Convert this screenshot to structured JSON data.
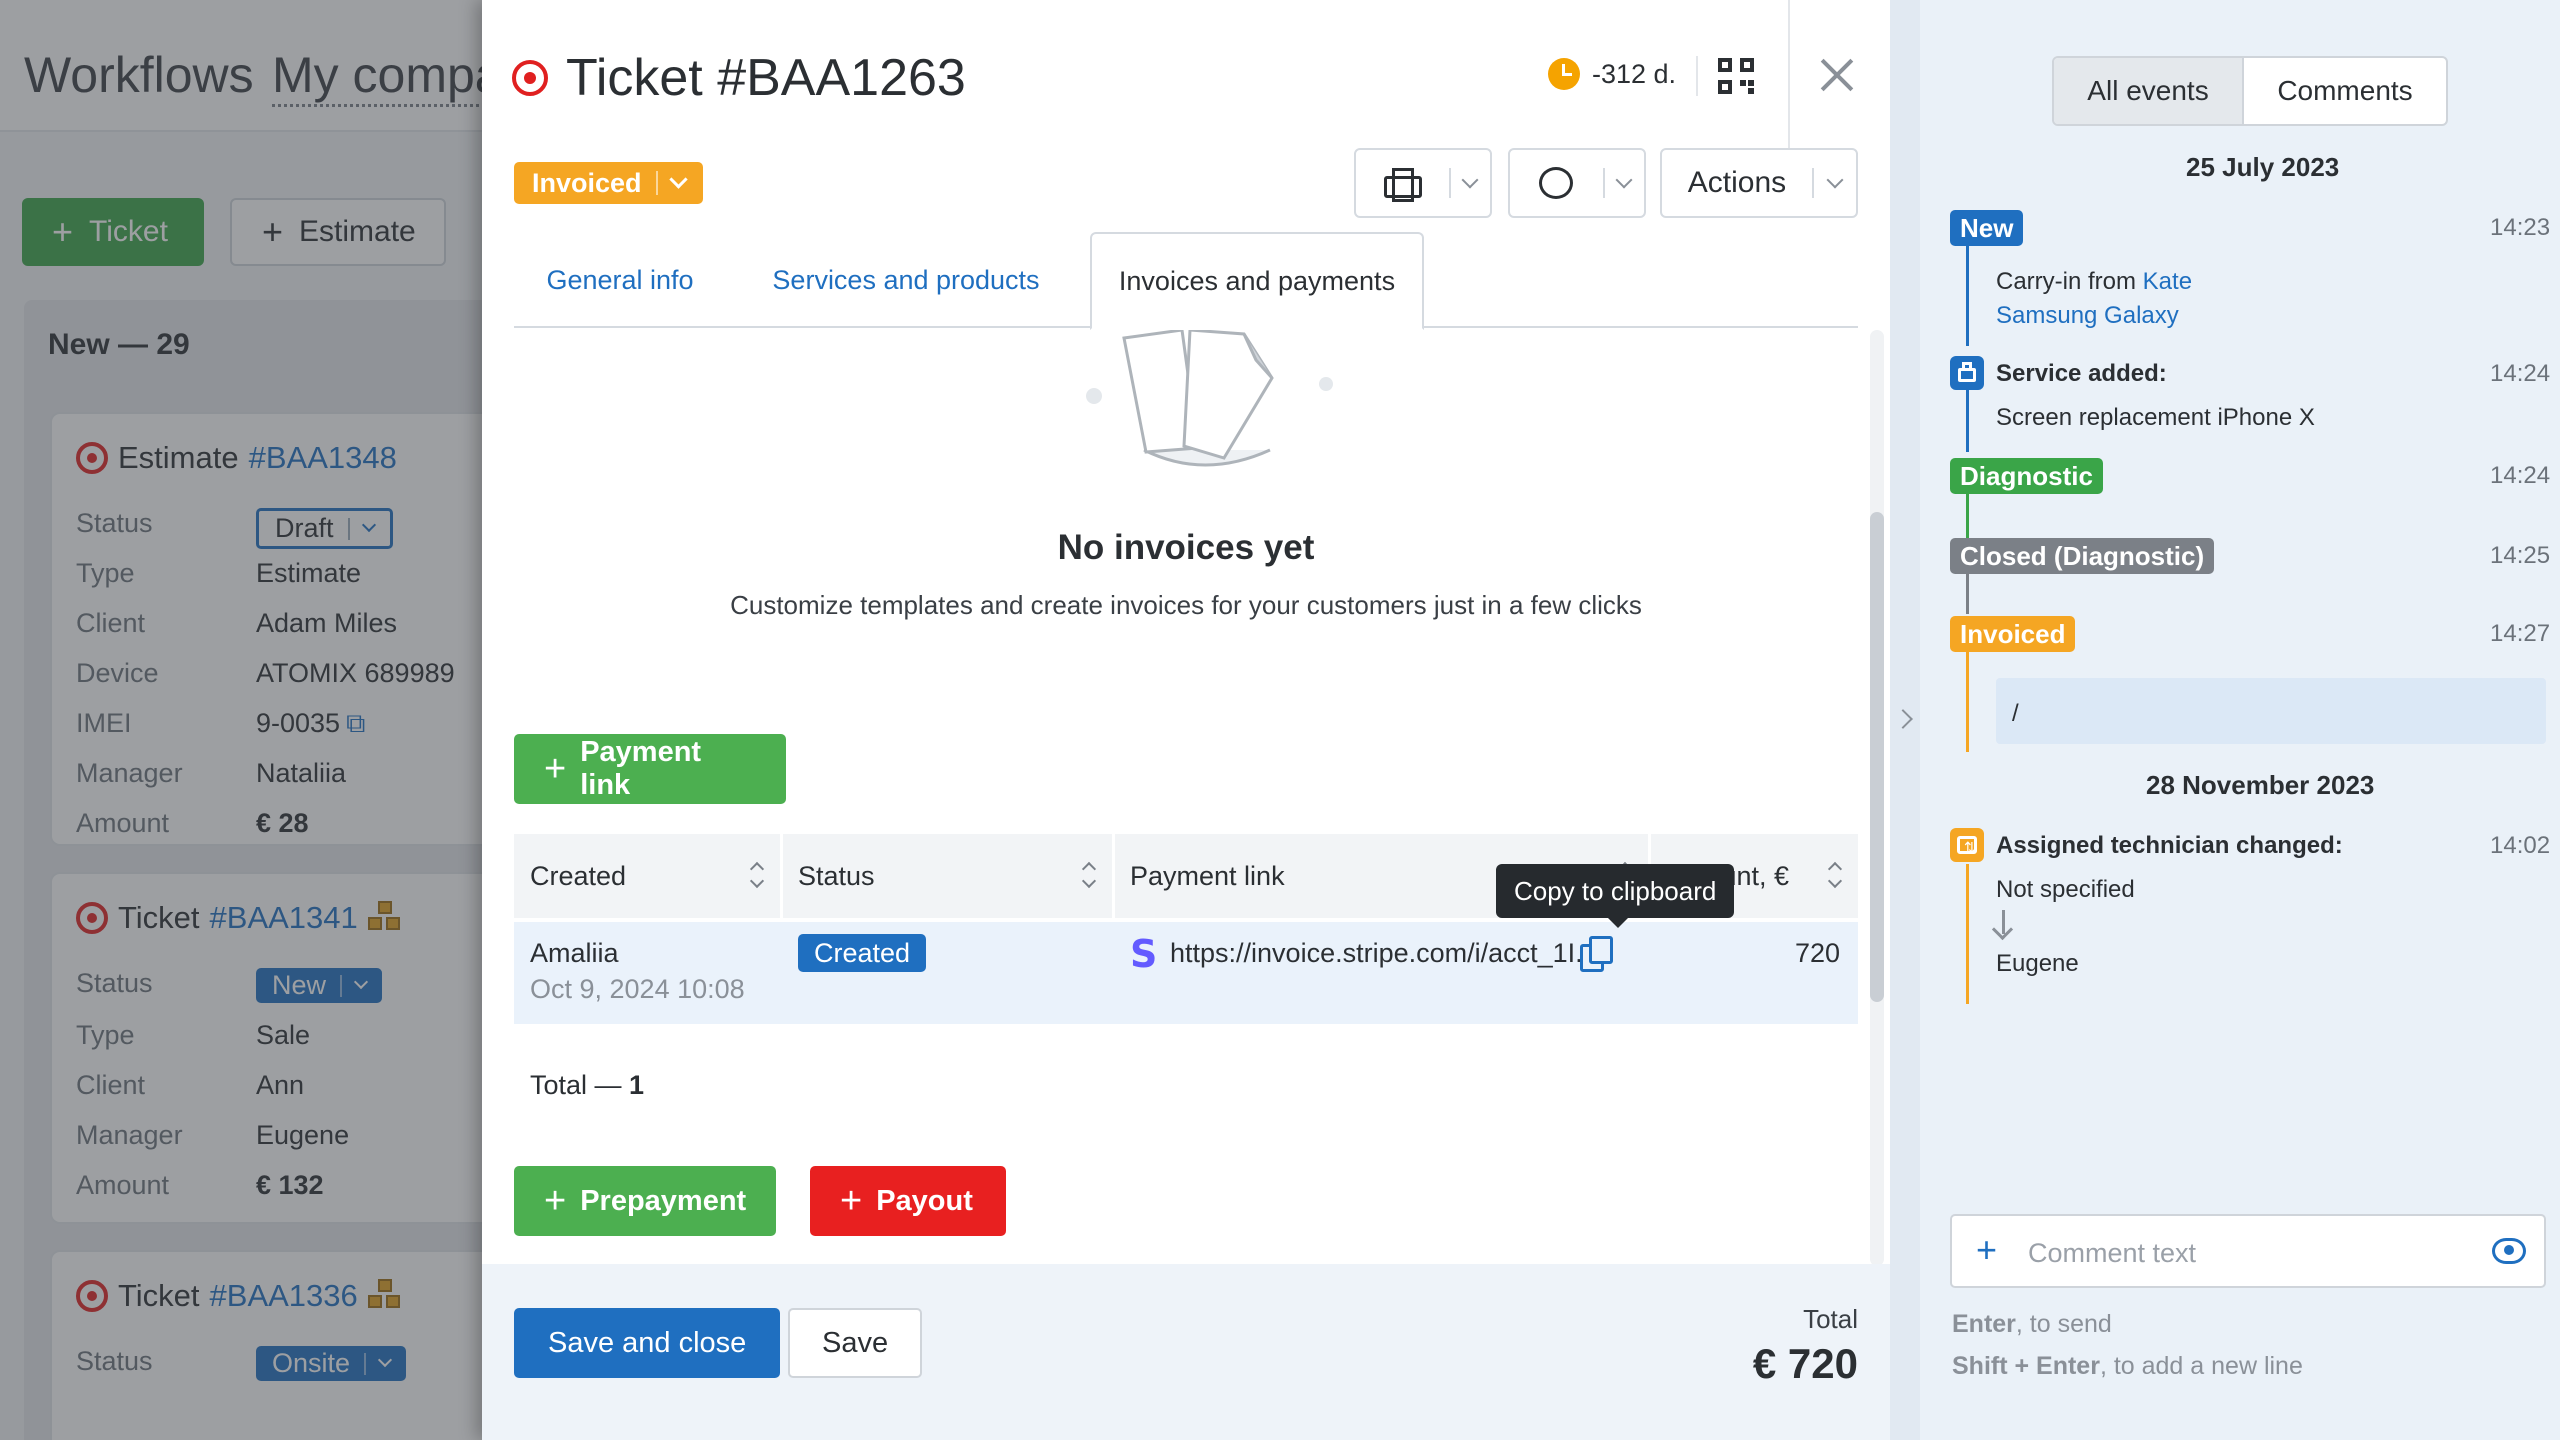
{
  "background": {
    "breadcrumb_workflows": "Workflows",
    "breadcrumb_company": "My compa",
    "new_ticket_label": "Ticket",
    "new_estimate_label": "Estimate",
    "column_title": "New — 29",
    "cards": [
      {
        "type_label": "Estimate",
        "number": "#BAA1348",
        "rows": [
          {
            "k": "Status",
            "v": "Draft"
          },
          {
            "k": "Type",
            "v": "Estimate"
          },
          {
            "k": "Client",
            "v": "Adam Miles"
          },
          {
            "k": "Device",
            "v": "ATOMIX 689989"
          },
          {
            "k": "IMEI",
            "v": "9-0035"
          },
          {
            "k": "Manager",
            "v": "Nataliia"
          },
          {
            "k": "Amount",
            "v": "€ 28"
          }
        ]
      },
      {
        "type_label": "Ticket",
        "number": "#BAA1341",
        "rows": [
          {
            "k": "Status",
            "v": "New"
          },
          {
            "k": "Type",
            "v": "Sale"
          },
          {
            "k": "Client",
            "v": "Ann"
          },
          {
            "k": "Manager",
            "v": "Eugene"
          },
          {
            "k": "Amount",
            "v": "€ 132"
          }
        ]
      },
      {
        "type_label": "Ticket",
        "number": "#BAA1336",
        "rows": [
          {
            "k": "Status",
            "v": "Onsite"
          }
        ]
      }
    ]
  },
  "modal": {
    "title": "Ticket #BAA1263",
    "timer": "-312 d.",
    "status": "Invoiced",
    "actions_label": "Actions",
    "tabs": [
      "General info",
      "Services and products",
      "Invoices and payments"
    ],
    "active_tab": "Invoices and payments",
    "empty_title": "No invoices yet",
    "empty_subtitle": "Customize templates and create invoices for your customers just in a few clicks",
    "payment_link_button": "Payment link",
    "table": {
      "columns": [
        "Created",
        "Status",
        "Payment link",
        "Amount, €"
      ],
      "rows": [
        {
          "created_by": "Amaliia",
          "created_at": "Oct 9, 2024 10:08",
          "status": "Created",
          "link": "https://invoice.stripe.com/i/acct_1I...",
          "amount": "720"
        }
      ],
      "total_label": "Total — ",
      "total_count": "1"
    },
    "tooltip": "Copy to clipboard",
    "prepayment_button": "Prepayment",
    "payout_button": "Payout",
    "save_close_button": "Save and close",
    "save_button": "Save",
    "total_label": "Total",
    "total_value": "€ 720"
  },
  "events": {
    "tabs": [
      "All events",
      "Comments"
    ],
    "dates": [
      "25 July 2023",
      "28 November 2023"
    ],
    "items": [
      {
        "badge": "New",
        "time": "14:23",
        "line1_prefix": "Carry-in from ",
        "line1_link": "Kate",
        "line2_link": "Samsung Galaxy"
      },
      {
        "title": "Service added:",
        "time": "14:24",
        "detail": "Screen replacement iPhone X"
      },
      {
        "badge": "Diagnostic",
        "time": "14:24"
      },
      {
        "badge": "Closed (Diagnostic)",
        "time": "14:25"
      },
      {
        "badge": "Invoiced",
        "time": "14:27",
        "note": "/"
      },
      {
        "title": "Assigned technician changed:",
        "time": "14:02",
        "from": "Not specified",
        "to": "Eugene"
      }
    ],
    "comment_placeholder": "Comment text",
    "hint1_key": "Enter",
    "hint1_text": ", to send",
    "hint2_key": "Shift + Enter",
    "hint2_text": ", to add a new line"
  },
  "colors": {
    "accent": "#1f6fc0",
    "green": "#4caf50",
    "red": "#e82020",
    "invoiced": "#f5a623",
    "diagnostic": "#3aa548",
    "closed": "#7b8087"
  }
}
